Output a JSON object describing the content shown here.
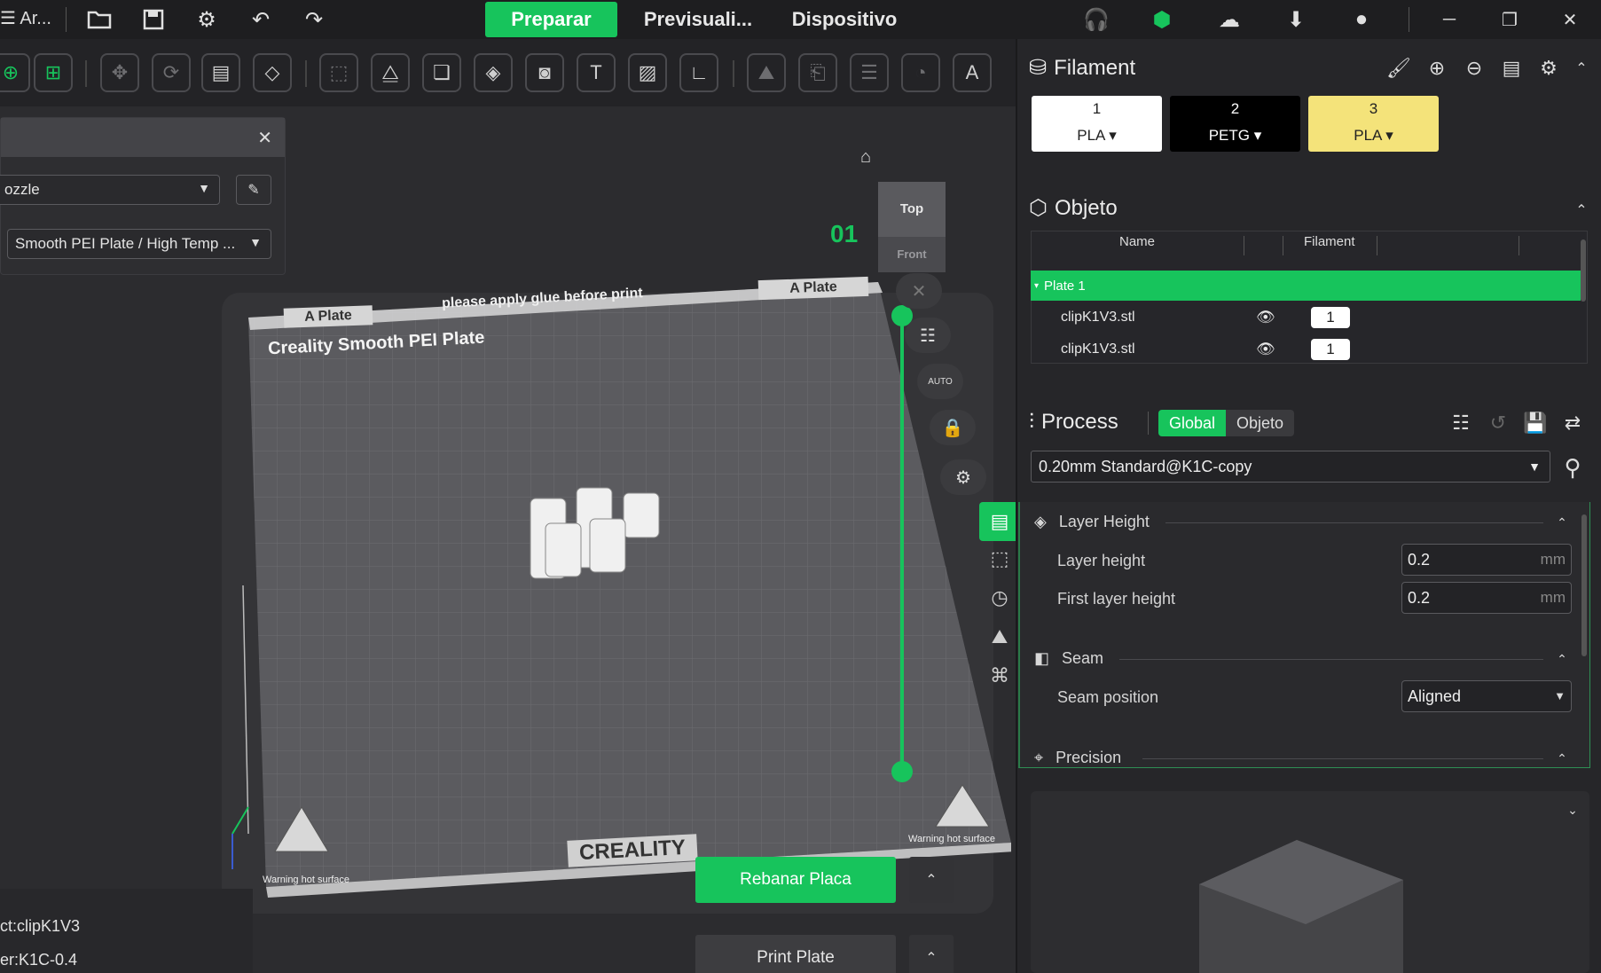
{
  "titlebar": {
    "app_label": "Ar...",
    "tabs": [
      {
        "label": "Preparar",
        "active": true
      },
      {
        "label": "Previsuali...",
        "active": false
      },
      {
        "label": "Dispositivo",
        "active": false
      }
    ],
    "icons": [
      "folder-open-icon",
      "save-icon",
      "settings-icon",
      "undo-icon",
      "redo-icon",
      "headset-icon",
      "cube-icon",
      "upload-cloud-icon",
      "download-icon",
      "user-icon"
    ],
    "window_controls": [
      "minimize-icon",
      "restore-icon",
      "close-icon"
    ]
  },
  "left_panel": {
    "nozzle_value": "ozzle",
    "plate_type_value": "Smooth PEI Plate / High Temp ..."
  },
  "viewport": {
    "plate_labels": {
      "a_plate_left": "A Plate",
      "a_plate_right": "A Plate",
      "glue_notice": "please apply glue before print",
      "plate_name": "Creality Smooth PEI Plate",
      "brand": "CREALITY",
      "warning_left": "Warning hot surface",
      "warning_right": "Warning hot surface"
    },
    "plate_index": "01",
    "view_cube": {
      "top": "Top",
      "front": "Front"
    },
    "auto_label": "AUTO"
  },
  "actions": {
    "slice_button": "Rebanar Placa",
    "print_button": "Print Plate"
  },
  "status": {
    "object_line": "ct:clipK1V3",
    "printer_line": "er:K1C-0.4"
  },
  "filament": {
    "title": "Filament",
    "slots": [
      {
        "index": "1",
        "type": "PLA",
        "color": "#ffffff",
        "text_color": "#222222"
      },
      {
        "index": "2",
        "type": "PETG",
        "color": "#000000",
        "text_color": "#ffffff"
      },
      {
        "index": "3",
        "type": "PLA",
        "color": "#f4e37a",
        "text_color": "#222222"
      }
    ]
  },
  "objects": {
    "title": "Objeto",
    "columns": [
      "Name",
      "Filament"
    ],
    "plate_row": "Plate 1",
    "rows": [
      {
        "name": "clipK1V3.stl",
        "filament": "1"
      },
      {
        "name": "clipK1V3.stl",
        "filament": "1"
      }
    ]
  },
  "process": {
    "title": "Process",
    "toggle": {
      "global": "Global",
      "object": "Objeto"
    },
    "preset": "0.20mm Standard@K1C-copy",
    "groups": {
      "layer_height": "Layer Height",
      "seam": "Seam",
      "precision": "Precision"
    },
    "options": {
      "layer_height_label": "Layer height",
      "layer_height_value": "0.2",
      "first_layer_label": "First layer height",
      "first_layer_value": "0.2",
      "unit": "mm",
      "seam_position_label": "Seam position",
      "seam_position_value": "Aligned"
    }
  },
  "colors": {
    "accent": "#17c45c",
    "background": "#2b2b2e"
  }
}
